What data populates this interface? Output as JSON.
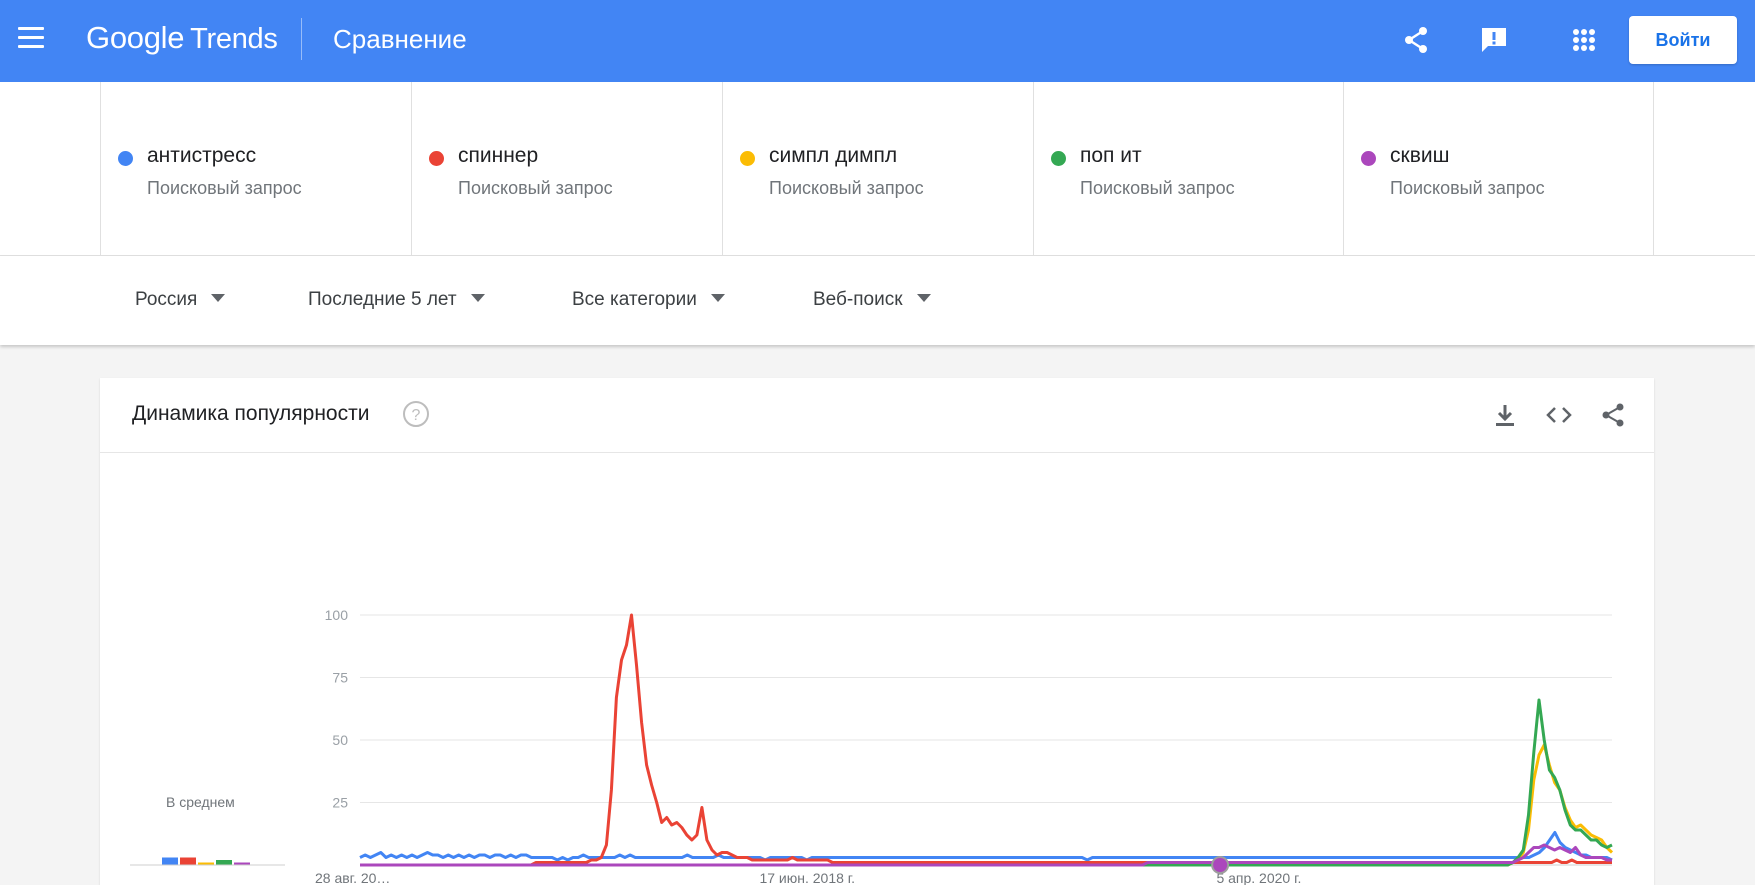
{
  "header": {
    "logo_google": "Google",
    "logo_trends": "Trends",
    "title": "Сравнение",
    "login_label": "Войти",
    "bg_color": "#4285f4"
  },
  "terms": [
    {
      "name": "антистресс",
      "sub": "Поисковый запрос",
      "color": "#4285f4"
    },
    {
      "name": "спиннер",
      "sub": "Поисковый запрос",
      "color": "#ea4335"
    },
    {
      "name": "симпл димпл",
      "sub": "Поисковый запрос",
      "color": "#fbbc04"
    },
    {
      "name": "поп ит",
      "sub": "Поисковый запрос",
      "color": "#34a853"
    },
    {
      "name": "сквиш",
      "sub": "Поисковый запрос",
      "color": "#ab47bc"
    }
  ],
  "filters": {
    "region": "Россия",
    "period": "Последние 5 лет",
    "category": "Все категории",
    "search_type": "Веб-поиск"
  },
  "card": {
    "title": "Динамика популярности",
    "avg_label": "В среднем"
  },
  "chart_data": {
    "type": "line",
    "y_ticks": [
      "100",
      "75",
      "50",
      "25"
    ],
    "ylim": [
      0,
      100
    ],
    "x_tick_labels": [
      "28 авг. 20…",
      "17 июн. 2018 г.",
      "5 апр. 2020 г."
    ],
    "grid": true,
    "averages": [
      {
        "name": "антистресс",
        "value": 3,
        "color": "#4285f4"
      },
      {
        "name": "спиннер",
        "value": 3,
        "color": "#ea4335"
      },
      {
        "name": "симпл димпл",
        "value": 1,
        "color": "#fbbc04"
      },
      {
        "name": "поп ит",
        "value": 2,
        "color": "#34a853"
      },
      {
        "name": "сквиш",
        "value": 1,
        "color": "#ab47bc"
      }
    ],
    "series": [
      {
        "name": "антистресс",
        "color": "#4285f4",
        "values": [
          3,
          4,
          3,
          4,
          5,
          3,
          4,
          3,
          4,
          3,
          4,
          3,
          4,
          5,
          4,
          4,
          3,
          4,
          3,
          4,
          3,
          4,
          3,
          4,
          4,
          3,
          4,
          4,
          3,
          4,
          3,
          4,
          4,
          3,
          3,
          3,
          3,
          3,
          2,
          3,
          2,
          3,
          3,
          4,
          3,
          3,
          3,
          3,
          3,
          3,
          4,
          3,
          4,
          3,
          3,
          3,
          3,
          3,
          3,
          3,
          3,
          3,
          3,
          4,
          3,
          3,
          3,
          3,
          3,
          4,
          3,
          3,
          3,
          3,
          3,
          3,
          3,
          3,
          2,
          3,
          3,
          3,
          3,
          3,
          3,
          3,
          2,
          3,
          3,
          3,
          3,
          3,
          3,
          3,
          3,
          3,
          3,
          3,
          3,
          3,
          3,
          3,
          3,
          3,
          3,
          3,
          3,
          3,
          3,
          3,
          3,
          3,
          3,
          3,
          3,
          3,
          3,
          3,
          3,
          3,
          3,
          3,
          3,
          3,
          3,
          3,
          3,
          3,
          3,
          3,
          3,
          3,
          3,
          3,
          3,
          3,
          3,
          3,
          3,
          3,
          2,
          3,
          3,
          3,
          3,
          3,
          3,
          3,
          3,
          3,
          3,
          3,
          3,
          3,
          3,
          3,
          3,
          3,
          3,
          3,
          3,
          3,
          3,
          3,
          3,
          3,
          3,
          3,
          3,
          3,
          3,
          3,
          3,
          3,
          3,
          3,
          3,
          3,
          3,
          3,
          3,
          3,
          3,
          3,
          3,
          3,
          3,
          3,
          3,
          3,
          3,
          3,
          3,
          3,
          3,
          3,
          3,
          3,
          3,
          3,
          3,
          3,
          3,
          3,
          3,
          3,
          3,
          3,
          3,
          3,
          3,
          3,
          3,
          3,
          3,
          3,
          3,
          3,
          3,
          3,
          3,
          3,
          3,
          3,
          3,
          3,
          4,
          5,
          7,
          10,
          13,
          9,
          7,
          6,
          5,
          4,
          4,
          3,
          3,
          3,
          3,
          2
        ]
      },
      {
        "name": "спиннер",
        "color": "#ea4335",
        "values": [
          0,
          0,
          0,
          0,
          0,
          0,
          0,
          0,
          0,
          0,
          0,
          0,
          0,
          0,
          0,
          0,
          0,
          0,
          0,
          0,
          0,
          0,
          0,
          0,
          0,
          0,
          0,
          0,
          0,
          0,
          0,
          0,
          0,
          0,
          0,
          1,
          1,
          1,
          1,
          1,
          1,
          1,
          1,
          1,
          1,
          1,
          2,
          2,
          3,
          8,
          30,
          67,
          82,
          88,
          100,
          80,
          57,
          40,
          32,
          25,
          17,
          19,
          16,
          17,
          15,
          12,
          10,
          12,
          23,
          10,
          6,
          4,
          5,
          5,
          4,
          3,
          3,
          3,
          2,
          2,
          2,
          2,
          2,
          2,
          2,
          2,
          3,
          2,
          2,
          2,
          2,
          2,
          2,
          2,
          1,
          1,
          1,
          1,
          1,
          1,
          1,
          1,
          1,
          1,
          1,
          1,
          1,
          1,
          1,
          1,
          1,
          1,
          1,
          1,
          1,
          1,
          1,
          1,
          1,
          1,
          1,
          1,
          1,
          1,
          1,
          1,
          1,
          1,
          1,
          1,
          1,
          1,
          1,
          1,
          1,
          1,
          1,
          1,
          1,
          1,
          1,
          1,
          1,
          1,
          1,
          1,
          1,
          1,
          1,
          1,
          1,
          1,
          1,
          1,
          1,
          1,
          1,
          1,
          1,
          1,
          1,
          1,
          1,
          1,
          1,
          1,
          1,
          1,
          1,
          1,
          1,
          1,
          1,
          1,
          1,
          1,
          1,
          1,
          1,
          1,
          1,
          1,
          1,
          1,
          1,
          1,
          1,
          1,
          1,
          1,
          1,
          1,
          1,
          1,
          1,
          1,
          1,
          1,
          1,
          1,
          1,
          1,
          1,
          1,
          1,
          1,
          1,
          1,
          1,
          1,
          1,
          1,
          1,
          1,
          1,
          1,
          1,
          1,
          1,
          1,
          1,
          1,
          1,
          1,
          1,
          1,
          1,
          1,
          1,
          1,
          1,
          1,
          1,
          1,
          1,
          1,
          1,
          1,
          2,
          1,
          1,
          2,
          1,
          1,
          1,
          1,
          1,
          1,
          1,
          1
        ]
      },
      {
        "name": "симпл димпл",
        "color": "#fbbc04",
        "values": [
          0,
          0,
          0,
          0,
          0,
          0,
          0,
          0,
          0,
          0,
          0,
          0,
          0,
          0,
          0,
          0,
          0,
          0,
          0,
          0,
          0,
          0,
          0,
          0,
          0,
          0,
          0,
          0,
          0,
          0,
          0,
          0,
          0,
          0,
          0,
          0,
          0,
          0,
          0,
          0,
          0,
          0,
          0,
          0,
          0,
          0,
          0,
          0,
          0,
          0,
          0,
          0,
          0,
          0,
          0,
          0,
          0,
          0,
          0,
          0,
          0,
          0,
          0,
          0,
          0,
          0,
          0,
          0,
          0,
          0,
          0,
          0,
          0,
          0,
          0,
          0,
          0,
          0,
          0,
          0,
          0,
          0,
          0,
          0,
          0,
          0,
          0,
          0,
          0,
          0,
          0,
          0,
          0,
          0,
          0,
          0,
          0,
          0,
          0,
          0,
          0,
          0,
          0,
          0,
          0,
          0,
          0,
          0,
          0,
          0,
          0,
          0,
          0,
          0,
          0,
          0,
          0,
          0,
          0,
          0,
          0,
          0,
          0,
          0,
          0,
          0,
          0,
          0,
          0,
          0,
          0,
          0,
          0,
          0,
          0,
          0,
          0,
          0,
          0,
          0,
          0,
          0,
          0,
          0,
          0,
          0,
          0,
          0,
          0,
          0,
          0,
          0,
          0,
          0,
          0,
          0,
          0,
          0,
          0,
          0,
          0,
          0,
          0,
          0,
          0,
          0,
          0,
          0,
          0,
          0,
          0,
          0,
          0,
          0,
          0,
          0,
          0,
          0,
          0,
          0,
          0,
          0,
          0,
          0,
          0,
          0,
          0,
          0,
          0,
          0,
          0,
          0,
          0,
          0,
          0,
          0,
          0,
          0,
          0,
          0,
          0,
          0,
          0,
          0,
          0,
          0,
          0,
          0,
          0,
          0,
          0,
          0,
          0,
          0,
          0,
          0,
          0,
          0,
          0,
          0,
          0,
          1,
          2,
          5,
          14,
          34,
          44,
          48,
          40,
          33,
          30,
          23,
          18,
          15,
          16,
          14,
          12,
          11,
          10,
          7,
          5
        ]
      },
      {
        "name": "поп ит",
        "color": "#34a853",
        "values": [
          0,
          0,
          0,
          0,
          0,
          0,
          0,
          0,
          0,
          0,
          0,
          0,
          0,
          0,
          0,
          0,
          0,
          0,
          0,
          0,
          0,
          0,
          0,
          0,
          0,
          0,
          0,
          0,
          0,
          0,
          0,
          0,
          0,
          0,
          0,
          0,
          0,
          0,
          0,
          0,
          0,
          0,
          0,
          0,
          0,
          0,
          0,
          0,
          0,
          0,
          0,
          0,
          0,
          0,
          0,
          0,
          0,
          0,
          0,
          0,
          0,
          0,
          0,
          0,
          0,
          0,
          0,
          0,
          0,
          0,
          0,
          0,
          0,
          0,
          0,
          0,
          0,
          0,
          0,
          0,
          0,
          0,
          0,
          0,
          0,
          0,
          0,
          0,
          0,
          0,
          0,
          0,
          0,
          0,
          0,
          0,
          0,
          0,
          0,
          0,
          0,
          0,
          0,
          0,
          0,
          0,
          0,
          0,
          0,
          0,
          0,
          0,
          0,
          0,
          0,
          0,
          0,
          0,
          0,
          0,
          0,
          0,
          0,
          0,
          0,
          0,
          0,
          0,
          0,
          0,
          0,
          0,
          0,
          0,
          0,
          0,
          0,
          0,
          0,
          0,
          0,
          0,
          0,
          0,
          0,
          0,
          0,
          0,
          0,
          0,
          0,
          0,
          0,
          0,
          0,
          0,
          0,
          0,
          0,
          0,
          0,
          0,
          0,
          0,
          0,
          0,
          0,
          0,
          0,
          0,
          0,
          0,
          0,
          0,
          0,
          0,
          0,
          0,
          0,
          0,
          0,
          0,
          0,
          0,
          0,
          0,
          0,
          0,
          0,
          0,
          0,
          0,
          0,
          0,
          0,
          0,
          0,
          0,
          0,
          0,
          0,
          0,
          0,
          0,
          0,
          0,
          0,
          0,
          0,
          0,
          0,
          0,
          0,
          0,
          0,
          0,
          0,
          0,
          0,
          0,
          0,
          1,
          3,
          6,
          20,
          45,
          66,
          50,
          38,
          35,
          30,
          22,
          16,
          14,
          14,
          12,
          10,
          10,
          8,
          7,
          8
        ]
      },
      {
        "name": "сквиш",
        "color": "#ab47bc",
        "values": [
          0,
          0,
          0,
          0,
          0,
          0,
          0,
          0,
          0,
          0,
          0,
          0,
          0,
          0,
          0,
          0,
          0,
          0,
          0,
          0,
          0,
          0,
          0,
          0,
          0,
          0,
          0,
          0,
          0,
          0,
          0,
          0,
          0,
          0,
          0,
          0,
          0,
          0,
          0,
          0,
          0,
          0,
          0,
          0,
          0,
          0,
          0,
          0,
          0,
          0,
          0,
          0,
          0,
          0,
          0,
          0,
          0,
          0,
          0,
          0,
          0,
          0,
          0,
          0,
          0,
          0,
          0,
          0,
          0,
          0,
          0,
          0,
          0,
          0,
          0,
          0,
          0,
          0,
          0,
          0,
          0,
          0,
          0,
          0,
          0,
          0,
          0,
          0,
          0,
          0,
          0,
          0,
          0,
          0,
          0,
          0,
          0,
          0,
          0,
          0,
          0,
          0,
          0,
          0,
          0,
          0,
          0,
          0,
          0,
          0,
          0,
          0,
          0,
          0,
          0,
          0,
          0,
          0,
          0,
          0,
          0,
          0,
          0,
          0,
          0,
          0,
          0,
          0,
          0,
          0,
          0,
          0,
          0,
          0,
          0,
          0,
          0,
          0,
          0,
          0,
          0,
          0,
          0,
          0,
          0,
          0,
          0,
          0,
          0,
          0,
          0,
          1,
          1,
          1,
          1,
          1,
          1,
          1,
          1,
          1,
          1,
          1,
          1,
          1,
          1,
          1,
          1,
          1,
          1,
          1,
          1,
          1,
          1,
          1,
          1,
          1,
          1,
          1,
          1,
          1,
          1,
          1,
          1,
          1,
          1,
          1,
          1,
          1,
          1,
          1,
          1,
          1,
          1,
          1,
          1,
          1,
          1,
          1,
          1,
          1,
          1,
          1,
          1,
          1,
          1,
          1,
          1,
          1,
          1,
          1,
          1,
          1,
          1,
          1,
          1,
          1,
          1,
          1,
          1,
          1,
          1,
          1,
          2,
          3,
          5,
          7,
          7,
          8,
          7,
          6,
          7,
          6,
          5,
          7,
          4,
          3,
          3,
          3,
          3,
          2,
          2
        ]
      }
    ]
  }
}
